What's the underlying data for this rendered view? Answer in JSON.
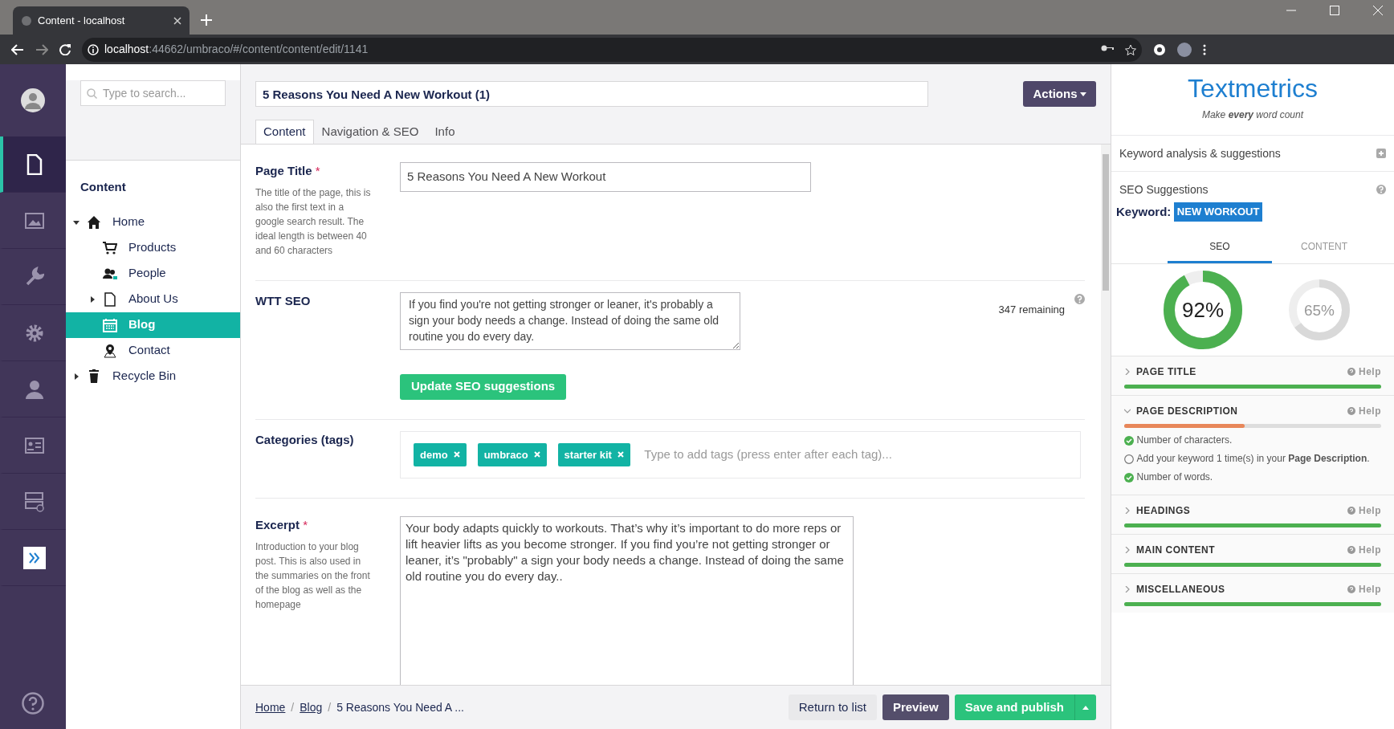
{
  "browser": {
    "tab_title": "Content - localhost",
    "url_host": "localhost",
    "url_path": ":44662/umbraco/#/content/content/edit/1141"
  },
  "sections": [
    {
      "selected": true
    },
    {
      "selected": false
    },
    {
      "selected": false
    },
    {
      "selected": false
    },
    {
      "selected": false
    },
    {
      "selected": false
    },
    {
      "selected": false
    },
    {
      "selected": false
    }
  ],
  "tree": {
    "search_placeholder": "Type to search...",
    "heading": "Content",
    "items": [
      {
        "label": "Home",
        "kind": "home",
        "selected": false,
        "expanded": true,
        "children": [
          {
            "label": "Products",
            "kind": "cart",
            "selected": false
          },
          {
            "label": "People",
            "kind": "people",
            "selected": false
          },
          {
            "label": "About Us",
            "kind": "page",
            "selected": false,
            "expanded": false
          },
          {
            "label": "Blog",
            "kind": "calendar",
            "selected": true
          },
          {
            "label": "Contact",
            "kind": "pin",
            "selected": false
          }
        ]
      },
      {
        "label": "Recycle Bin",
        "kind": "trash",
        "selected": false,
        "expanded": false
      }
    ]
  },
  "editor": {
    "name_value": "5 Reasons You Need A New Workout (1)",
    "actions": "Actions",
    "tabs": [
      {
        "label": "Content",
        "selected": true
      },
      {
        "label": "Navigation & SEO",
        "selected": false
      },
      {
        "label": "Info",
        "selected": false
      }
    ],
    "fields": [
      {
        "kind": "text",
        "label": "Page Title",
        "required_mark": "*",
        "description": "The title of the page, this is also the first text in a google search result. The ideal length is between 40 and 60 characters",
        "value": "5 Reasons You Need A New Workout"
      },
      {
        "kind": "seo",
        "label": "WTT SEO",
        "value": "If you find you're not getting stronger or leaner, it's probably a sign your body needs a change. Instead of doing the same old routine you do every day.",
        "remaining": "347 remaining",
        "button": "Update SEO suggestions"
      },
      {
        "kind": "tags",
        "label": "Categories (tags)",
        "tags": [
          "demo",
          "umbraco",
          "starter kit"
        ],
        "placeholder": "Type to add tags (press enter after each tag)..."
      },
      {
        "kind": "textarea",
        "label": "Excerpt",
        "required_mark": "*",
        "description": "Introduction to your blog post. This is also used in the summaries on the front of the blog as well as the homepage",
        "value": "Your body adapts quickly to workouts. That’s why it’s important to do more reps or lift heavier lifts as you become stronger. If you find you’re not getting stronger or leaner, it’s \"probably\" a sign your body needs a change. Instead of doing the same old routine you do every day.."
      }
    ]
  },
  "footer": {
    "breadcrumb": [
      "Home",
      "Blog",
      "5 Reasons You Need A ..."
    ],
    "separator": "/",
    "buttons": [
      {
        "label": "Return to list",
        "kind": "plain"
      },
      {
        "label": "Preview",
        "kind": "secondary"
      },
      {
        "label": "Save and publish",
        "kind": "primary"
      }
    ]
  },
  "textmetrics": {
    "logo": "Textmetrics",
    "tagline": "Make **every** word count",
    "keyword_analysis": "Keyword analysis & suggestions",
    "seo_suggestions": "SEO Suggestions",
    "keyword_label": "Keyword:",
    "keyword": "NEW WORKOUT",
    "tabs": [
      {
        "label": "SEO",
        "selected": true
      },
      {
        "label": "CONTENT",
        "selected": false
      }
    ],
    "scores": [
      {
        "reading": "92%",
        "level": 0.92,
        "selected": true
      },
      {
        "reading": "65%",
        "level": 0.65,
        "selected": false
      }
    ],
    "groups": [
      {
        "title": "PAGE TITLE",
        "help": "Help",
        "expanded": false,
        "level": 1,
        "color": "#4cb050"
      },
      {
        "title": "PAGE DESCRIPTION",
        "help": "Help",
        "expanded": true,
        "level": 0.47,
        "color": "#e8875a",
        "checks": [
          {
            "text": "Number of characters.",
            "checked": true
          },
          {
            "text": "Add your keyword 1 time(s) in your **Page Description**.",
            "checked": false
          },
          {
            "text": "Number of words.",
            "checked": true
          }
        ]
      },
      {
        "title": "HEADINGS",
        "help": "Help",
        "expanded": false,
        "level": 1,
        "color": "#4cb050"
      },
      {
        "title": "MAIN CONTENT",
        "help": "Help",
        "expanded": false,
        "level": 1,
        "color": "#4cb050"
      },
      {
        "title": "MISCELLANEOUS",
        "help": "Help",
        "expanded": false,
        "level": 1,
        "color": "#4cb050"
      }
    ]
  }
}
